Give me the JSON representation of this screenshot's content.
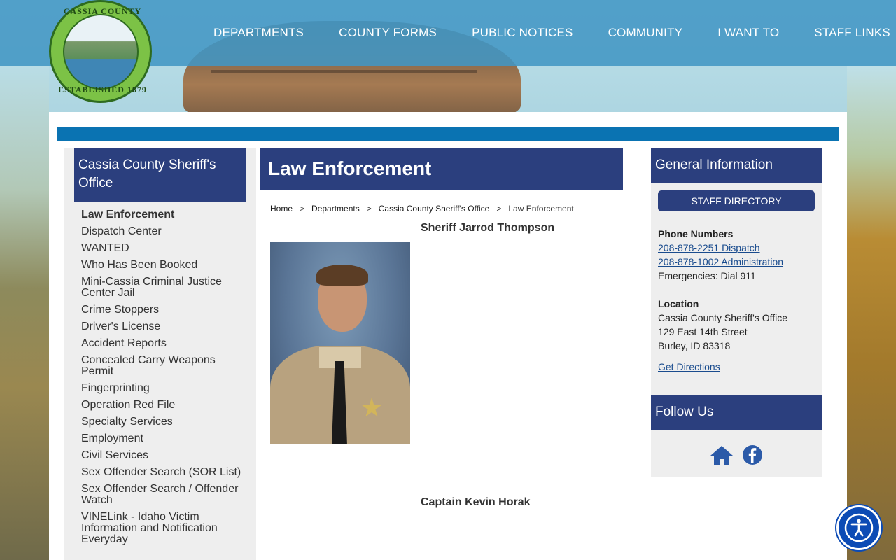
{
  "logo": {
    "top_text": "CASSIA COUNTY IDAHO",
    "bottom_text": "ESTABLISHED 1879"
  },
  "nav": {
    "items": [
      "DEPARTMENTS",
      "COUNTY FORMS",
      "PUBLIC NOTICES",
      "COMMUNITY",
      "I WANT TO",
      "STAFF LINKS"
    ]
  },
  "sidebar": {
    "title": "Cassia County Sheriff's Office",
    "items": [
      "Law Enforcement",
      "Dispatch Center",
      "WANTED",
      "Who Has Been Booked",
      "Mini-Cassia Criminal Justice Center Jail",
      "Crime Stoppers",
      "Driver's License",
      "Accident Reports",
      "Concealed Carry Weapons Permit",
      "Fingerprinting",
      "Operation Red File",
      "Specialty Services",
      "Employment",
      "Civil Services",
      "Sex Offender Search (SOR List)",
      "Sex Offender Search / Offender Watch",
      "VINELink - Idaho Victim Information and Notification Everyday"
    ]
  },
  "main": {
    "title": "Law Enforcement",
    "breadcrumb": [
      "Home",
      "Departments",
      "Cassia County Sheriff's Office",
      "Law Enforcement"
    ],
    "breadcrumb_sep": ">",
    "sheriff_name": "Sheriff Jarrod Thompson",
    "captain_name": "Captain Kevin Horak"
  },
  "info": {
    "title": "General Information",
    "staff_button": "STAFF DIRECTORY",
    "phone_label": "Phone Numbers",
    "phone_dispatch": "208-878-2251 Dispatch",
    "phone_admin": "208-878-1002 Administration",
    "emergency": "Emergencies: Dial 911",
    "location_label": "Location",
    "location_name": "Cassia County Sheriff's Office",
    "street": "129 East 14th Street",
    "city": "Burley, ID 83318",
    "directions": "Get Directions"
  },
  "follow": {
    "title": "Follow Us"
  },
  "colors": {
    "navy": "#2b3f7e",
    "accent_blue": "#0a73b2",
    "link": "#1a4c8e"
  }
}
